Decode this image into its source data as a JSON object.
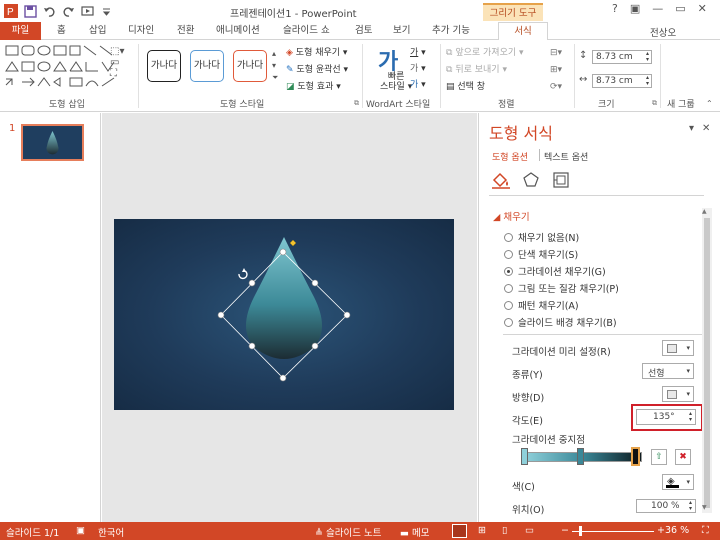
{
  "window": {
    "title": "프레젠테이션1 - PowerPoint",
    "contextual_tab_group": "그리기 도구",
    "user": "전상오",
    "controls": [
      "?",
      "▣",
      "—",
      "▭",
      "✕"
    ]
  },
  "tabs": [
    "파일",
    "홈",
    "삽입",
    "디자인",
    "전환",
    "애니메이션",
    "슬라이드 쇼",
    "검토",
    "보기",
    "추가 기능",
    "서식"
  ],
  "ribbon": {
    "insert_shapes_label": "도형 삽입",
    "shape_styles_label": "도형 스타일",
    "style_preview_text": "가나다",
    "shape_fill": "도형 채우기",
    "shape_outline": "도형 윤곽선",
    "shape_effects": "도형 효과",
    "quick_styles": "빠른\n스타일",
    "quick_styles_line1": "빠른",
    "quick_styles_line2": "스타일",
    "wordart_label": "WordArt 스타일",
    "bring_forward": "앞으로 가져오기",
    "send_backward": "뒤로 보내기",
    "selection_pane": "선택 창",
    "arrange_label": "정렬",
    "height": "8.73 cm",
    "width": "8.73 cm",
    "size_label": "크기",
    "new_group": "새 그룹"
  },
  "slides_pane": {
    "slide_number": "1"
  },
  "format_pane": {
    "title": "도형 서식",
    "tab_shape_options": "도형 옵션",
    "tab_text_options": "텍스트 옵션",
    "section_fill": "채우기",
    "fill_options": [
      {
        "label": "채우기 없음(N)",
        "selected": false
      },
      {
        "label": "단색 채우기(S)",
        "selected": false
      },
      {
        "label": "그라데이션 채우기(G)",
        "selected": true
      },
      {
        "label": "그림 또는 질감 채우기(P)",
        "selected": false
      },
      {
        "label": "패턴 채우기(A)",
        "selected": false
      },
      {
        "label": "슬라이드 배경 채우기(B)",
        "selected": false
      }
    ],
    "preset_label": "그라데이션 미리 설정(R)",
    "type_label": "종류(Y)",
    "type_value": "선형",
    "direction_label": "방향(D)",
    "angle_label": "각도(E)",
    "angle_value": "135°",
    "stops_label": "그라데이션 중지점",
    "color_label": "색(C)",
    "position_label": "위치(O)",
    "position_value": "100 %"
  },
  "status": {
    "slide_info": "슬라이드 1/1",
    "language": "한국어",
    "notes": "슬라이드 노트",
    "comments": "메모",
    "zoom": "36 %"
  },
  "colors": {
    "accent": "#d24726",
    "highlight_box": "#d0202a",
    "slide_bg": "#1f3b5a",
    "drop_top": "#7fc6d0",
    "drop_bottom": "#1c2c33"
  }
}
